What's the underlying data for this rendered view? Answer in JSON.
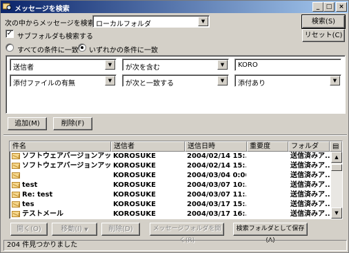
{
  "window": {
    "title": "メッセージを検索",
    "minimize": "_",
    "maximize": "□",
    "close": "×"
  },
  "search": {
    "scope_label": "次の中からメッセージを検索(H):",
    "scope_value": "ローカルフォルダ",
    "include_subfolders_label": "サブフォルダも検索する",
    "include_subfolders_checked": true,
    "match_all_label": "すべての条件に一致",
    "match_any_label": "いずれかの条件に一致",
    "selected_match": "any",
    "search_button": "検索(S)",
    "reset_button": "リセット(C)"
  },
  "criteria": [
    {
      "field": "送信者",
      "operator": "が次を含む",
      "value": "KORO",
      "value_is_dropdown": false
    },
    {
      "field": "添付ファイルの有無",
      "operator": "が次と一致する",
      "value": "添付あり",
      "value_is_dropdown": true
    }
  ],
  "criteria_buttons": {
    "add": "追加(M)",
    "remove": "削除(F)"
  },
  "results": {
    "columns": [
      "件名",
      "送信者",
      "送信日時",
      "重要度",
      "フォルダ"
    ],
    "rows": [
      {
        "subject": "ソフトウェアバージョンアップの...",
        "sender": "KOROSUKE",
        "date": "2004/02/14 15:...",
        "priority": "",
        "folder": "送信済みア..."
      },
      {
        "subject": "ソフトウェアバージョンアップの...",
        "sender": "KOROSUKE",
        "date": "2004/02/14 15:...",
        "priority": "",
        "folder": "送信済みア..."
      },
      {
        "subject": "",
        "sender": "KOROSUKE",
        "date": "2004/03/04 0:06",
        "priority": "",
        "folder": "送信済みア..."
      },
      {
        "subject": "test",
        "sender": "KOROSUKE",
        "date": "2004/03/07 10:...",
        "priority": "",
        "folder": "送信済みア..."
      },
      {
        "subject": "Re: test",
        "sender": "KOROSUKE",
        "date": "2004/03/07 11:...",
        "priority": "",
        "folder": "送信済みア..."
      },
      {
        "subject": "tes",
        "sender": "KOROSUKE",
        "date": "2004/03/17 15:...",
        "priority": "",
        "folder": "送信済みア..."
      },
      {
        "subject": "テストメール",
        "sender": "KOROSUKE",
        "date": "2004/03/17 16:...",
        "priority": "",
        "folder": "送信済みア..."
      }
    ]
  },
  "actions": {
    "open": "開く(O)",
    "move": "移動(I)",
    "delete": "削除(D)",
    "open_folder": "メッセージフォルダを開く(R)",
    "save_as_folder": "検索フォルダとして保存(A)"
  },
  "status_text": "204 件見つかりました"
}
